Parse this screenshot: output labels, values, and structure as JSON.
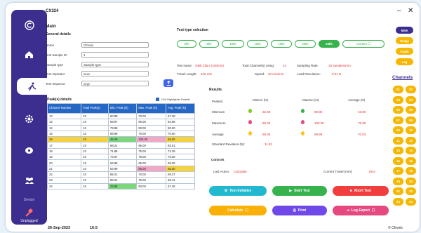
{
  "app": {
    "title": "CX324",
    "brand": "© Cfronix"
  },
  "sidebar": {
    "device_label": "Device",
    "unplugged_label": "Unplugged"
  },
  "main": {
    "heading": "Main",
    "general_title": "General details"
  },
  "general": {
    "name_label": "Name",
    "name_value": "Cfronix",
    "sample_id_label": "Test Sample ID",
    "sample_id_value": "1",
    "sample_type_label": "Sample type",
    "sample_type_value": "Sample type",
    "operator_label": "Test Operator",
    "operator_value": "xxxx",
    "inspector_label": "Test Inspector",
    "inspector_value": "yyyy"
  },
  "test_type": {
    "title": "Test type selection",
    "options": [
      "5hk",
      "8kk",
      "10kk",
      "12kk",
      "16kk",
      "20kk",
      "24kk",
      "Custom"
    ],
    "selected": "24kk"
  },
  "params": {
    "name_label": "Test name:",
    "name_value": "24kk CBLs (150mm)",
    "channels_label": "Total Channel(s) using:",
    "channels_value": "24",
    "rate_label": "Sampling Rate:",
    "rate_value": "10 samples/mm",
    "travel_label": "Travel Length:",
    "travel_value": "310 mm",
    "speed_label": "Speed:",
    "speed_value": "20 mm/min",
    "load_label": "Load Resolution:",
    "load_value": "0.01 N"
  },
  "peaks": {
    "title": "Peak(s) details",
    "highlighter_label": "Cell Highlighter Enable",
    "columns": [
      "Channel Number",
      "Total Peak(s)",
      "Min. Peak (N)",
      "Max. Peak (N)",
      "Avg. Peak (N)"
    ],
    "rows": [
      [
        "12",
        "10",
        "60.88",
        "70.00",
        "67.28"
      ],
      [
        "13",
        "10",
        "59.97",
        "80.00",
        "64.96"
      ],
      [
        "14",
        "10",
        "79.98",
        "80.00",
        "80.00"
      ],
      [
        "15",
        "10",
        "69.99",
        "70.00",
        "70.00"
      ],
      [
        "16",
        "10",
        "45.46",
        "100.00",
        "65.00"
      ],
      [
        "17",
        "10",
        "68.21",
        "85.00",
        "83.01"
      ],
      [
        "18",
        "10",
        "71.88",
        "75.00",
        "72.28"
      ],
      [
        "19",
        "10",
        "74.97",
        "75.00",
        "75.00"
      ],
      [
        "20",
        "10",
        "64.98",
        "65.00",
        "65.00"
      ],
      [
        "21",
        "10",
        "54.99",
        "55.00",
        "55.00"
      ],
      [
        "22",
        "10",
        "88.21",
        "70.00",
        "69.37"
      ],
      [
        "23",
        "10",
        "85.21",
        "75.00",
        "65.41"
      ],
      [
        "24",
        "10",
        "32.88",
        "60.00",
        "57.28"
      ]
    ]
  },
  "results": {
    "title": "Results",
    "col_peak": "Peak(s)",
    "col_min": "Minimo (N)",
    "col_max": "Maximo (N)",
    "col_avg": "Average (N)",
    "minimum_label": "Minimum",
    "min_min": "32.88",
    "min_max": "99.98",
    "min_avg": "48.00",
    "maximum_label": "Maximum",
    "max_min": "85.00",
    "max_max": "100.00",
    "max_avg": "75.00",
    "average_label": "Average",
    "avg_min": "59.00",
    "avg_max": "99.99",
    "avg_avg": "70.03",
    "std_label": "Standard Deviation (N):",
    "std_value": "11.92"
  },
  "controls": {
    "title": "Controls",
    "last_action_label": "Last Action:",
    "last_action_value": "Calculate",
    "travel_label": "Current Travel (mm):",
    "travel_value": "65.0",
    "btn_init": "Test Initialize",
    "btn_start": "Start Test",
    "btn_abort": "Abort Test",
    "btn_calc": "Calculate",
    "btn_print": "Print",
    "btn_export": "Log Export"
  },
  "right_panel": {
    "tabs": [
      "Main",
      "Range",
      "Graph",
      "Log"
    ],
    "channels_title": "Channels",
    "channels": [
      "01",
      "02",
      "03",
      "04",
      "05",
      "06",
      "07",
      "08",
      "09",
      "10",
      "11",
      "12",
      "13",
      "14",
      "15",
      "16",
      "17",
      "18",
      "19",
      "20",
      "21",
      "22",
      "23",
      "24"
    ]
  },
  "footer": {
    "date": "26-Sep-2023",
    "time": "16:5",
    "copyright": "© Cfronix"
  },
  "colors": {
    "sidebar": "#3b2e8f",
    "accent_green": "#37b24d",
    "channel_yellow": "#f5b700",
    "table_header": "#2567c4"
  }
}
